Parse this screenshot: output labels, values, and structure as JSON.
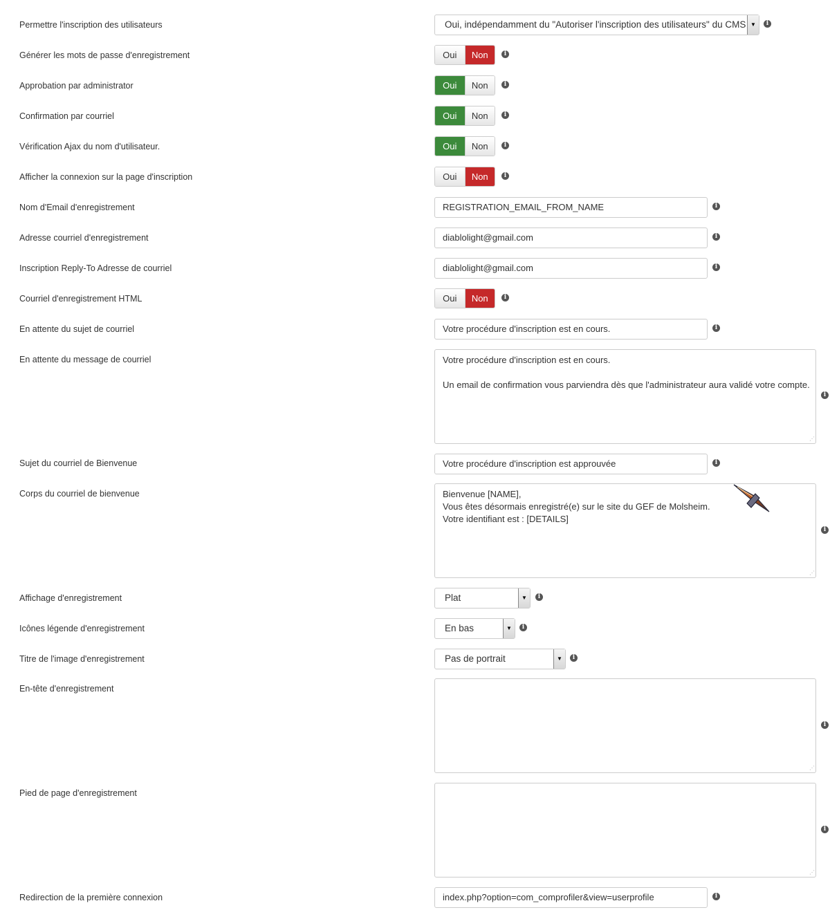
{
  "fields": {
    "allow_registration": {
      "label": "Permettre l'inscription des utilisateurs",
      "value": "Oui, indépendamment du \"Autoriser l'inscription des utilisateurs\" du CMS"
    },
    "generate_passwords": {
      "label": "Générer les mots de passe d'enregistrement",
      "yes": "Oui",
      "no": "Non",
      "selected": "Non"
    },
    "admin_approval": {
      "label": "Approbation par administrator",
      "yes": "Oui",
      "no": "Non",
      "selected": "Oui"
    },
    "email_confirmation": {
      "label": "Confirmation par courriel",
      "yes": "Oui",
      "no": "Non",
      "selected": "Oui"
    },
    "ajax_username_check": {
      "label": "Vérification Ajax du nom d'utilisateur.",
      "yes": "Oui",
      "no": "Non",
      "selected": "Oui"
    },
    "show_login_on_register": {
      "label": "Afficher la connexion sur la page d'inscription",
      "yes": "Oui",
      "no": "Non",
      "selected": "Non"
    },
    "registration_email_name": {
      "label": "Nom d'Email d'enregistrement",
      "value": "REGISTRATION_EMAIL_FROM_NAME"
    },
    "registration_email_address": {
      "label": "Adresse courriel d'enregistrement",
      "value": "diablolight@gmail.com"
    },
    "reply_to_address": {
      "label": "Inscription Reply-To Adresse de courriel",
      "value": "diablolight@gmail.com"
    },
    "html_email": {
      "label": "Courriel d'enregistrement HTML",
      "yes": "Oui",
      "no": "Non",
      "selected": "Non"
    },
    "pending_subject": {
      "label": "En attente du sujet de courriel",
      "value": "Votre procédure d'inscription est en cours."
    },
    "pending_message": {
      "label": "En attente du message de courriel",
      "lines": [
        "Votre procédure d'inscription est en cours.",
        "",
        "Un email de confirmation vous parviendra dès que l'administrateur aura validé votre compte."
      ]
    },
    "welcome_subject": {
      "label": "Sujet du courriel de Bienvenue",
      "value": "Votre procédure d'inscription est approuvée"
    },
    "welcome_body": {
      "label": "Corps du courriel de bienvenue",
      "lines": [
        "Bienvenue [NAME],",
        "Vous êtes désormais enregistré(e) sur le site du GEF de Molsheim.",
        "Votre identifiant est : [DETAILS]"
      ]
    },
    "registration_layout": {
      "label": "Affichage d'enregistrement",
      "value": "Plat"
    },
    "legend_icons": {
      "label": "Icônes légende d'enregistrement",
      "value": "En bas"
    },
    "image_title": {
      "label": "Titre de l'image d'enregistrement",
      "value": "Pas de portrait"
    },
    "registration_header": {
      "label": "En-tête d'enregistrement",
      "lines": []
    },
    "registration_footer": {
      "label": "Pied de page d'enregistrement",
      "lines": []
    },
    "first_login_redirect": {
      "label": "Redirection de la première connexion",
      "value": "index.php?option=com_comprofiler&view=userprofile"
    }
  },
  "icons": {
    "info": "info-circle-icon",
    "dropdown": "caret-down-icon",
    "cursor": "sword-cursor-icon",
    "resize": "resize-grip-icon"
  },
  "colors": {
    "yes_active": "#3c8a3b",
    "no_active": "#c5292a",
    "border": "#cccccc"
  }
}
